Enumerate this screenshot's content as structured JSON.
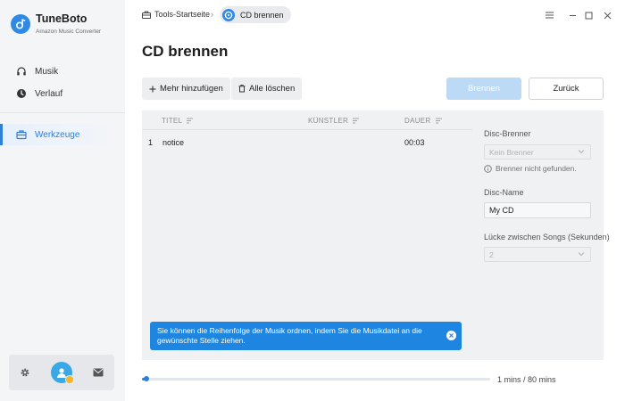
{
  "app": {
    "name": "TuneBoto",
    "subtitle": "Amazon Music Converter",
    "accent": "#2f8ae6"
  },
  "sidebar": {
    "items": [
      {
        "label": "Musik",
        "icon": "headphones-icon"
      },
      {
        "label": "Verlauf",
        "icon": "clock-icon"
      },
      {
        "label": "Werkzeuge",
        "icon": "toolbox-icon",
        "active": true
      }
    ],
    "bottom": {
      "settings_icon": "gear-icon",
      "avatar_icon": "user-avatar-icon",
      "mail_icon": "mail-icon"
    }
  },
  "breadcrumb": {
    "home": "Tools-Startseite",
    "current": "CD brennen"
  },
  "page": {
    "title": "CD brennen"
  },
  "toolbar": {
    "add_label": "Mehr hinzufügen",
    "clear_label": "Alle löschen",
    "burn_label": "Brennen",
    "back_label": "Zurück"
  },
  "table": {
    "columns": [
      "TITEL",
      "KÜNSTLER",
      "DAUER"
    ],
    "rows": [
      {
        "index": "1",
        "title": "notice",
        "artist": "",
        "duration": "00:03"
      }
    ]
  },
  "settings": {
    "burner_label": "Disc-Brenner",
    "burner_value": "Kein Brenner",
    "burner_info": "Brenner nicht gefunden.",
    "disc_name_label": "Disc-Name",
    "disc_name_value": "My CD",
    "gap_label": "Lücke zwischen Songs (Sekunden)",
    "gap_value": "2"
  },
  "toast": {
    "message": "Sie können die Reihenfolge der Musik ordnen, indem Sie die Musikdatei an die gewünschte Stelle ziehen."
  },
  "progress": {
    "text": "1 mins / 80 mins",
    "fraction": 0.0125
  }
}
